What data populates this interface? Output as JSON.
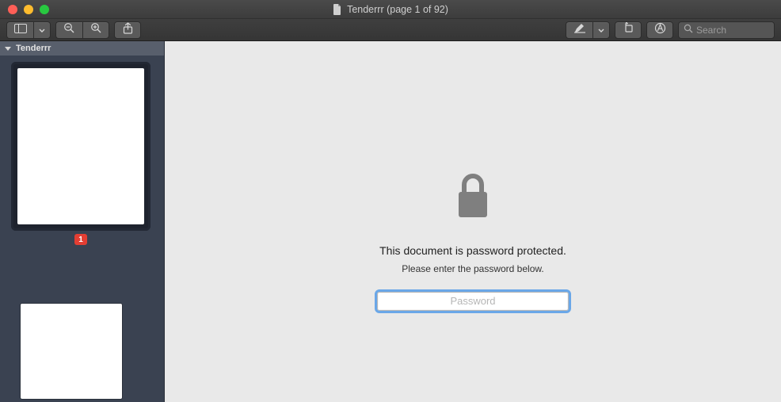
{
  "window": {
    "title": "Tenderrr (page 1 of 92)"
  },
  "toolbar": {
    "search_placeholder": "Search"
  },
  "sidebar": {
    "title": "Tenderrr",
    "pages": [
      {
        "number": "1"
      }
    ]
  },
  "main": {
    "lock_heading": "This document is password protected.",
    "lock_sub": "Please enter the password below.",
    "password_placeholder": "Password"
  }
}
